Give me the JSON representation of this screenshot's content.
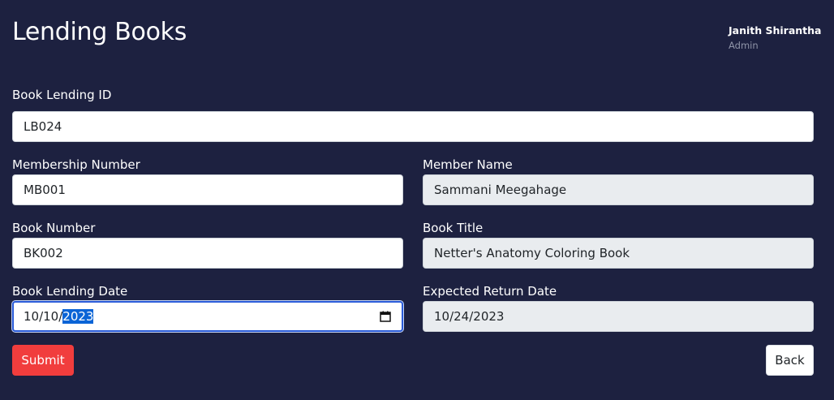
{
  "header": {
    "title": "Lending Books",
    "user_name": "Janith Shirantha",
    "user_role": "Admin"
  },
  "form": {
    "lending_id": {
      "label": "Book Lending ID",
      "value": "LB024"
    },
    "membership_number": {
      "label": "Membership Number",
      "value": "MB001"
    },
    "member_name": {
      "label": "Member Name",
      "value": "Sammani Meegahage"
    },
    "book_number": {
      "label": "Book Number",
      "value": "BK002"
    },
    "book_title": {
      "label": "Book Title",
      "value": "Netter's Anatomy Coloring Book"
    },
    "lending_date": {
      "label": "Book Lending Date",
      "value_prefix": "10/10/",
      "value_selected": "2023"
    },
    "return_date": {
      "label": "Expected Return Date",
      "value": "10/24/2023"
    }
  },
  "actions": {
    "submit_label": "Submit",
    "back_label": "Back"
  },
  "colors": {
    "background": "#1d2140",
    "submit": "#f13d3d",
    "focus_border": "#2a5bd7",
    "selection": "#0a64d6",
    "readonly_bg": "#e9ecef"
  },
  "icons": {
    "date_picker": "calendar-icon"
  }
}
